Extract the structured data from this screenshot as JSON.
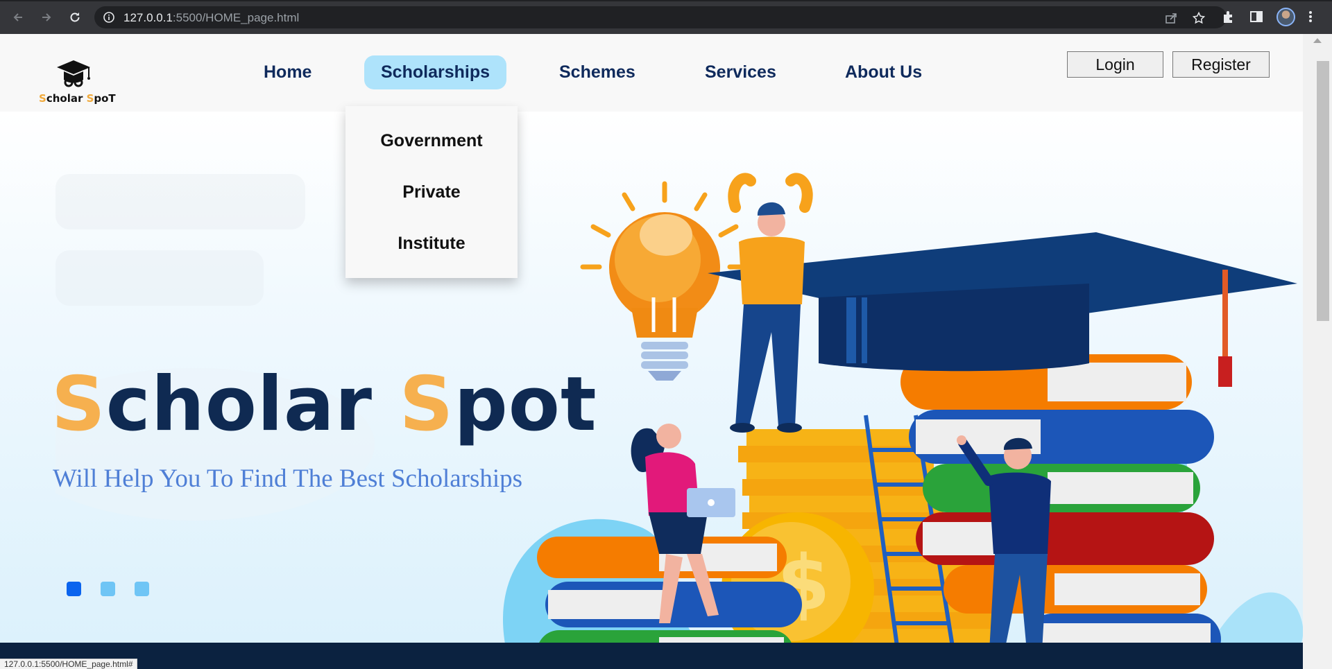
{
  "browser": {
    "url_host": "127.0.0.1",
    "url_rest": ":5500/HOME_page.html",
    "status_text": "127.0.0.1:5500/HOME_page.html#"
  },
  "header": {
    "logo_text_s1": "S",
    "logo_text_mid": "cholar ",
    "logo_text_s2": "S",
    "logo_text_end": "poT",
    "nav": {
      "home": "Home",
      "scholarships": "Scholarships",
      "schemes": "Schemes",
      "services": "Services",
      "about": "About Us"
    },
    "login_label": "Login",
    "register_label": "Register"
  },
  "dropdown": {
    "items": [
      "Government",
      "Private",
      "Institute"
    ]
  },
  "hero": {
    "title_s1": "S",
    "title_mid": "cholar ",
    "title_s2": "S",
    "title_end": "pot",
    "tagline": "Will Help You To Find The Best Scholarships",
    "active_slide": 1,
    "slide_count": 3
  },
  "colors": {
    "accent": "#f6b04f",
    "navy": "#0f2a52",
    "nav_active_bg": "#aee3fb",
    "dot_active": "#0a64ee",
    "dot_inactive": "#6fc5f5",
    "footer": "#0b2240"
  }
}
